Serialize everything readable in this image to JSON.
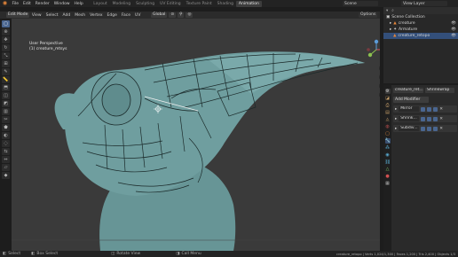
{
  "topbar": {
    "menus": [
      "File",
      "Edit",
      "Render",
      "Window",
      "Help"
    ],
    "workspaces": [
      "Layout",
      "Modeling",
      "Sculpting",
      "UV Editing",
      "Texture Paint",
      "Shading",
      "Animation"
    ],
    "active_workspace": "Animation",
    "scene": "Scene",
    "view_layer": "View Layer"
  },
  "viewport_header": {
    "mode": "Edit Mode",
    "menus": [
      "View",
      "Select",
      "Add",
      "Mesh",
      "Vertex",
      "Edge",
      "Face",
      "UV"
    ],
    "orientation": "Global",
    "options": "Options"
  },
  "viewport": {
    "view_name": "User Perspective",
    "object_name": "(1) creature_mtsys"
  },
  "outliner": {
    "header": "Scene Collection",
    "rows": [
      {
        "label": "Scene Collection",
        "indent": 0
      },
      {
        "label": "creature",
        "indent": 1
      },
      {
        "label": "Armature",
        "indent": 1
      },
      {
        "label": "creature_retopo",
        "indent": 2,
        "selected": true
      }
    ]
  },
  "properties": {
    "object_field": "creature_ret...",
    "modifier_field": "Shrinkwrap",
    "add_modifier": "Add Modifier",
    "modifiers": [
      {
        "name": "Mirror"
      },
      {
        "name": "Shrink..."
      },
      {
        "name": "Subdiv..."
      }
    ]
  },
  "statusbar": {
    "select": "Select",
    "box_select": "Box Select",
    "rotate": "Rotate View",
    "call_menu": "Call Menu",
    "stats": "creature_retopo | Verts 1,024/1,300 | Faces 1,200 | Tris 2,400 | Objects 1/3"
  },
  "colors": {
    "accent": "#e8873a",
    "selection": "#334f7a",
    "mesh": "#6f9e9f",
    "viewport_bg": "#3a3a3a"
  }
}
